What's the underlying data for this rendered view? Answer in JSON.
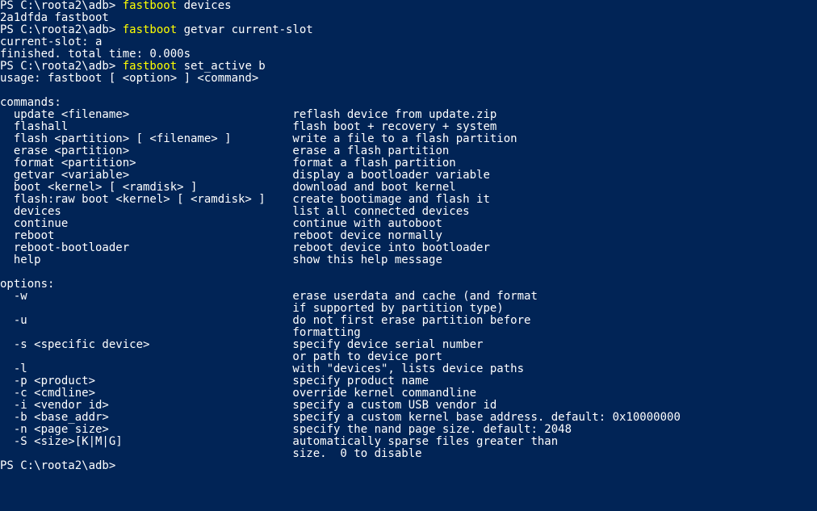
{
  "colors": {
    "bg": "#012456",
    "fg": "#ffffff",
    "hi": "#ffff00"
  },
  "prompt": "PS C:\\roota2\\adb>",
  "entries": [
    {
      "cmd": "fastboot",
      "args": "devices",
      "output": [
        "2a1dfda fastboot"
      ]
    },
    {
      "cmd": "fastboot",
      "args": "getvar current-slot",
      "output": [
        "current-slot: a",
        "finished. total time: 0.000s"
      ]
    },
    {
      "cmd": "fastboot",
      "args": "set_active b",
      "output": [
        "usage: fastboot [ <option> ] <command>",
        "",
        "commands:",
        "  update <filename>                        reflash device from update.zip",
        "  flashall                                 flash boot + recovery + system",
        "  flash <partition> [ <filename> ]         write a file to a flash partition",
        "  erase <partition>                        erase a flash partition",
        "  format <partition>                       format a flash partition",
        "  getvar <variable>                        display a bootloader variable",
        "  boot <kernel> [ <ramdisk> ]              download and boot kernel",
        "  flash:raw boot <kernel> [ <ramdisk> ]    create bootimage and flash it",
        "  devices                                  list all connected devices",
        "  continue                                 continue with autoboot",
        "  reboot                                   reboot device normally",
        "  reboot-bootloader                        reboot device into bootloader",
        "  help                                     show this help message",
        "",
        "options:",
        "  -w                                       erase userdata and cache (and format",
        "                                           if supported by partition type)",
        "  -u                                       do not first erase partition before",
        "                                           formatting",
        "  -s <specific device>                     specify device serial number",
        "                                           or path to device port",
        "  -l                                       with \"devices\", lists device paths",
        "  -p <product>                             specify product name",
        "  -c <cmdline>                             override kernel commandline",
        "  -i <vendor id>                           specify a custom USB vendor id",
        "  -b <base_addr>                           specify a custom kernel base address. default: 0x10000000",
        "  -n <page size>                           specify the nand page size. default: 2048",
        "  -S <size>[K|M|G]                         automatically sparse files greater than",
        "                                           size.  0 to disable"
      ]
    }
  ],
  "trailing_prompt": true
}
